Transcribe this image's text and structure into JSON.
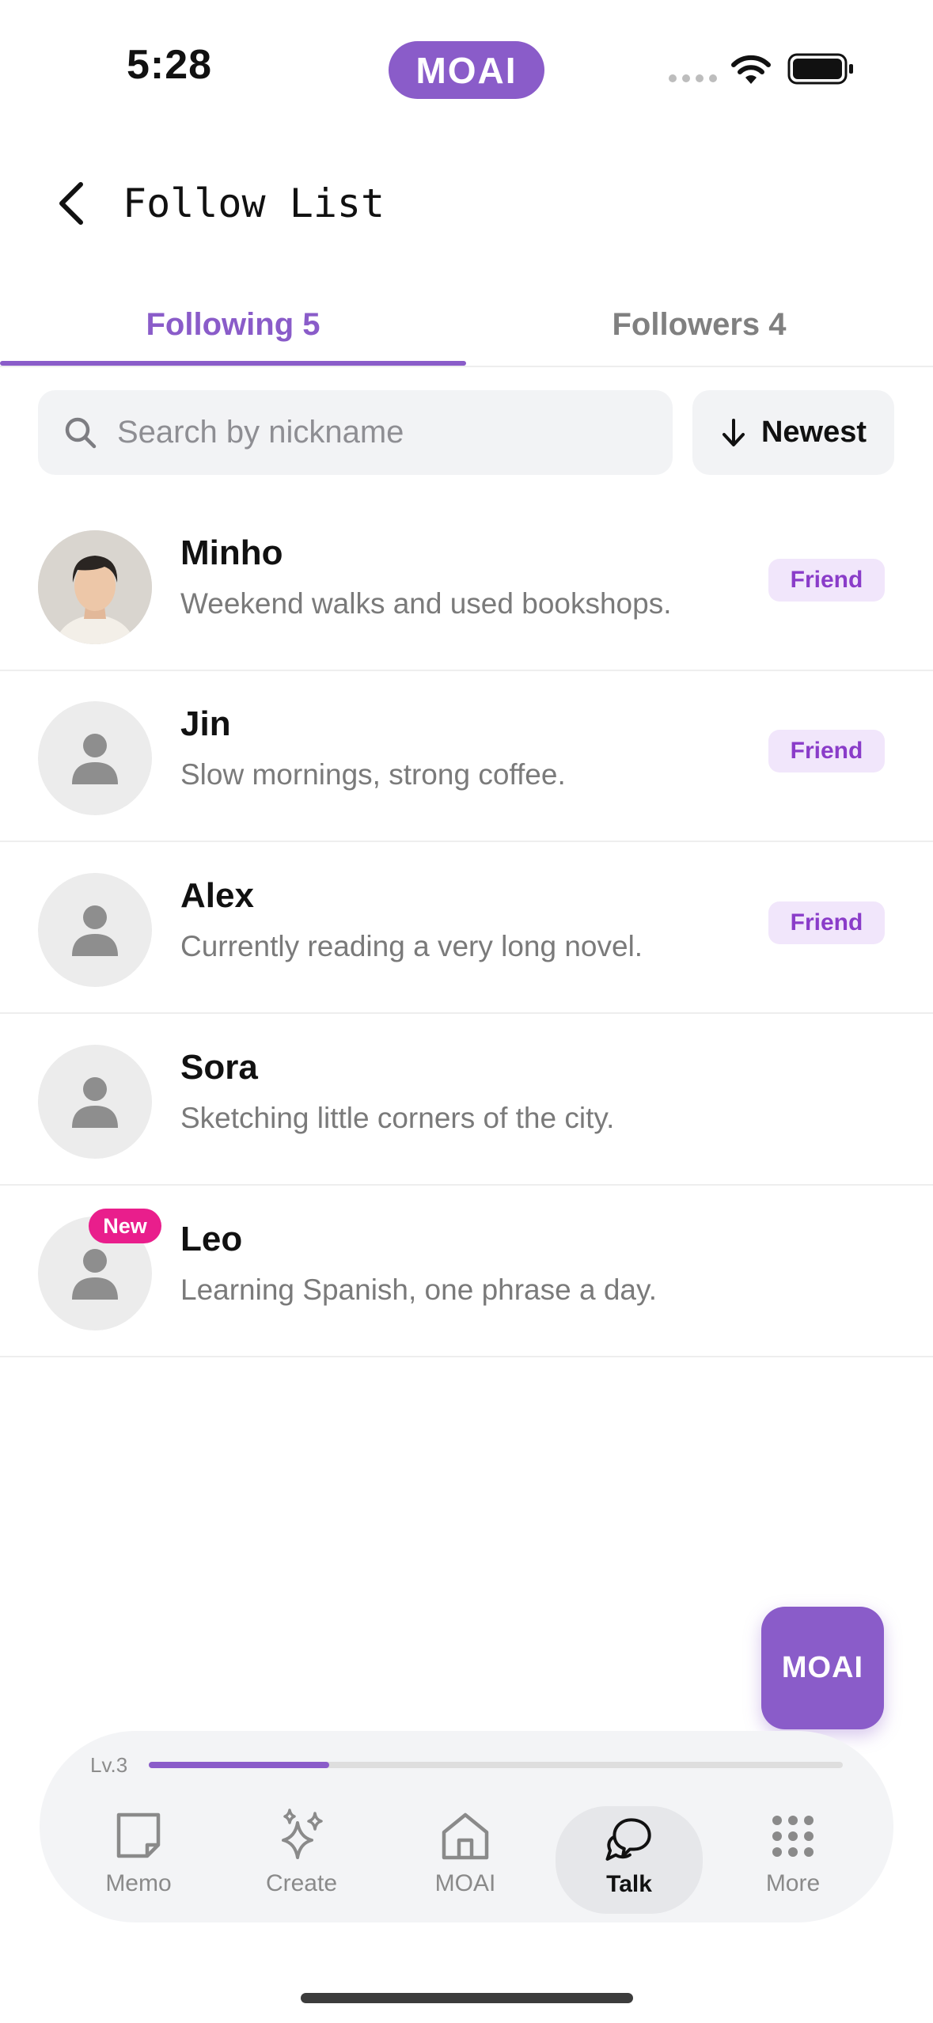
{
  "status_bar": {
    "time": "5:28",
    "app_pill": "MOAI",
    "icons": [
      "cellular-icon",
      "wifi-icon",
      "battery-icon"
    ]
  },
  "header": {
    "title": "Follow List",
    "back_icon": "chevron-left-icon"
  },
  "tabs": {
    "following": "Following 5",
    "followers": "Followers 4",
    "active": "following"
  },
  "search": {
    "placeholder": "Search by nickname",
    "value": ""
  },
  "sort": {
    "label": "Newest",
    "icon": "arrow-down-icon"
  },
  "following": [
    {
      "name": "Minho",
      "bio": "Weekend walks and used bookshops.",
      "badge": "Friend",
      "avatar": "photo"
    },
    {
      "name": "Jin",
      "bio": "Slow mornings, strong coffee.",
      "badge": "Friend",
      "avatar": "placeholder"
    },
    {
      "name": "Alex",
      "bio": "Currently reading a very long novel.",
      "badge": "Friend",
      "avatar": "placeholder"
    },
    {
      "name": "Sora",
      "bio": "Sketching little corners of the city.",
      "badge": "",
      "avatar": "placeholder"
    },
    {
      "name": "Leo",
      "bio": "Learning Spanish, one phrase a day.",
      "badge": "",
      "new_label": "New",
      "avatar": "placeholder"
    }
  ],
  "fab": {
    "label": "MOAI"
  },
  "level": {
    "label": "Lv.3",
    "progress": 0.26
  },
  "nav": {
    "items": [
      {
        "label": "Memo",
        "icon": "memo-icon"
      },
      {
        "label": "Create",
        "icon": "sparkles-icon"
      },
      {
        "label": "MOAI",
        "icon": "home-icon"
      },
      {
        "label": "Talk",
        "icon": "chat-bubbles-icon",
        "active": true
      },
      {
        "label": "More",
        "icon": "grid-icon"
      }
    ]
  },
  "colors": {
    "accent": "#8a5cc9",
    "badge_bg": "#f1e6fb",
    "badge_text": "#8a3cc9",
    "new_badge": "#e91e8c"
  }
}
